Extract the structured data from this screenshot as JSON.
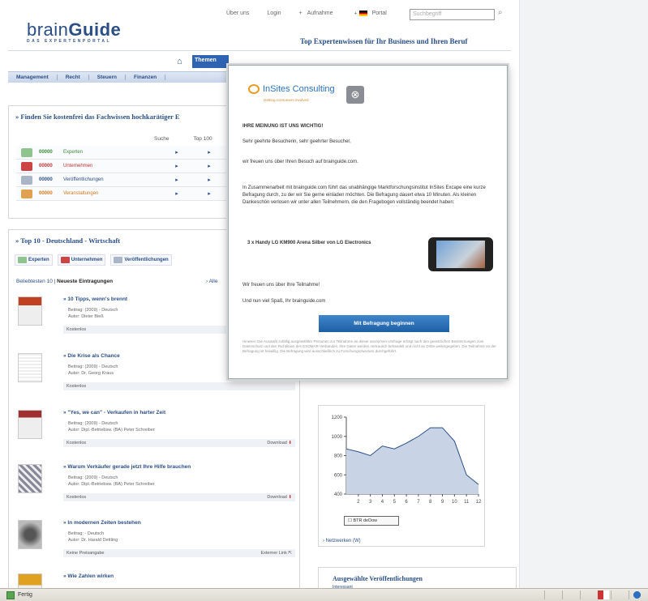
{
  "header": {
    "logo_part1": "brain",
    "logo_part2": "Guide",
    "logo_sub": "DAS EXPERTENPORTAL",
    "top_links": [
      "Über uns",
      "Login",
      "Aufnahme",
      "Portal"
    ],
    "search_placeholder": "Suchbegriff",
    "headline": "Top Expertenwissen für Ihr Business und Ihren Beruf",
    "home_icon": "home-icon",
    "themen_tab": "Themen"
  },
  "nav": {
    "items": [
      "Management",
      "Recht",
      "Steuern",
      "Finanzen"
    ]
  },
  "finden": {
    "title": "Finden Sie kostenfrei das Fachwissen hochkarätiger E",
    "col_headers": [
      "Suche",
      "Top 100"
    ],
    "rows": [
      {
        "num": "00000",
        "label": "Experten",
        "color": "#3b8a3b"
      },
      {
        "num": "00000",
        "label": "Unternehmen",
        "color": "#b33"
      },
      {
        "num": "00000",
        "label": "Veröffentlichungen",
        "color": "#2a4f86"
      },
      {
        "num": "00000",
        "label": "Veranstaltungen",
        "color": "#d07a20"
      }
    ]
  },
  "top10": {
    "title": "Top 10 - Deutschland - Wirtschaft",
    "tabs": [
      "Experten",
      "Unternehmen",
      "Veröffentlichungen"
    ],
    "sort_label": "Beliebtesten 10 |",
    "sort_active": "Neueste Eintragungen",
    "alle_link": "› Alle",
    "entries": [
      {
        "title": "10 Tipps, wenn's brennt",
        "meta1": "Beitrag: (2009) - Deutsch",
        "meta2": "Autor: Dieter Bieß",
        "bar_left": "Kostenlos",
        "bar_right": ""
      },
      {
        "title": "Die Krise als Chance",
        "meta1": "Beitrag: (2009) - Deutsch",
        "meta2": "Autor: Dr. Georg Kraus",
        "bar_left": "Kostenlos",
        "bar_right": ""
      },
      {
        "title": "\"Yes, we can\" - Verkaufen in harter Zeit",
        "meta1": "Beitrag: (2009) - Deutsch",
        "meta2": "Autor: Dipl.-Betriebsw. (BA) Peter Schreiber",
        "bar_left": "Kostenlos",
        "bar_right": "Download"
      },
      {
        "title": "Warum Verkäufer gerade jetzt Ihre Hilfe brauchen",
        "meta1": "Beitrag: (2009) - Deutsch",
        "meta2": "Autor: Dipl.-Betriebsw. (BA) Peter Schreiber",
        "bar_left": "Kostenlos",
        "bar_right": "Download"
      },
      {
        "title": "In modernen Zeiten bestehen",
        "meta1": "Beitrag: - Deutsch",
        "meta2": "Autor: Dr. Harald Dettling",
        "bar_left": "Keine Preisangabe",
        "bar_right": "Externer Link"
      },
      {
        "title": "Wie Zahlen wirken",
        "meta1": "",
        "meta2": "",
        "bar_left": "",
        "bar_right": ""
      }
    ]
  },
  "modal": {
    "brand": "InSites Consulting",
    "brand_sub": "Getting consumers involved",
    "heading": "IHRE MEINUNG IST UNS WICHTIG!",
    "greeting": "Sehr geehrte Besucherin, sehr geehrter Besucher,",
    "para1": "wir freuen uns über Ihren Besuch auf brainguide.com.",
    "para2": "In Zusammenarbeit mit brainguide.com führt das unabhängige Marktforschungsinstitut InSites Excape eine kurze Befragung durch, zu der wir Sie gerne einladen möchten. Die Befragung dauert etwa 10 Minuten. Als kleinen Dankeschön verlosen wir unter allen Teilnehmern, die den Fragebogen vollständig beendet haben:",
    "prize": "3 x Handy LG KM900 Arena Silber von LG Electronics",
    "thanks": "Wir freuen uns über Ihre Teilnahme!",
    "closing": "Und nun viel Spaß, Ihr brainguide.com",
    "button": "Mit Befragung beginnen",
    "small_print": "Hinweis: Die Auswahl zufällig ausgewählter Personen zur Teilnahme an dieser anonymen Umfrage erfolgt nach den gesetzlichen Bestimmungen zum Datenschutz und den Richtlinien des ESOMAR-Verbandes. Ihre Daten werden vertraulich behandelt und nicht an Dritte weitergegeben. Die Teilnahme an der Befragung ist freiwillig. Die Befragung wird ausschließlich zu Forschungszwecken durchgeführt."
  },
  "chart_data": {
    "type": "area",
    "x": [
      1,
      2,
      3,
      4,
      5,
      6,
      7,
      8,
      9,
      10,
      11,
      12
    ],
    "values": [
      870,
      840,
      800,
      900,
      870,
      930,
      1000,
      1090,
      1090,
      950,
      600,
      500
    ],
    "ylim": [
      400,
      1200
    ],
    "yticks": [
      400,
      600,
      800,
      1000,
      1200
    ],
    "xticks": [
      "2",
      "3",
      "4",
      "5",
      "6",
      "7",
      "8",
      "9",
      "10",
      "11",
      "12"
    ],
    "legend": "BTR deDow",
    "fill": "#c8d4e6",
    "stroke": "#2a4f86"
  },
  "right_links": {
    "netz": "› Netzwerken (W)"
  },
  "right_box": {
    "title": "Ausgewählte Veröffentlichungen",
    "subtitle": "Interessant"
  },
  "status": {
    "text": "Fertig"
  }
}
